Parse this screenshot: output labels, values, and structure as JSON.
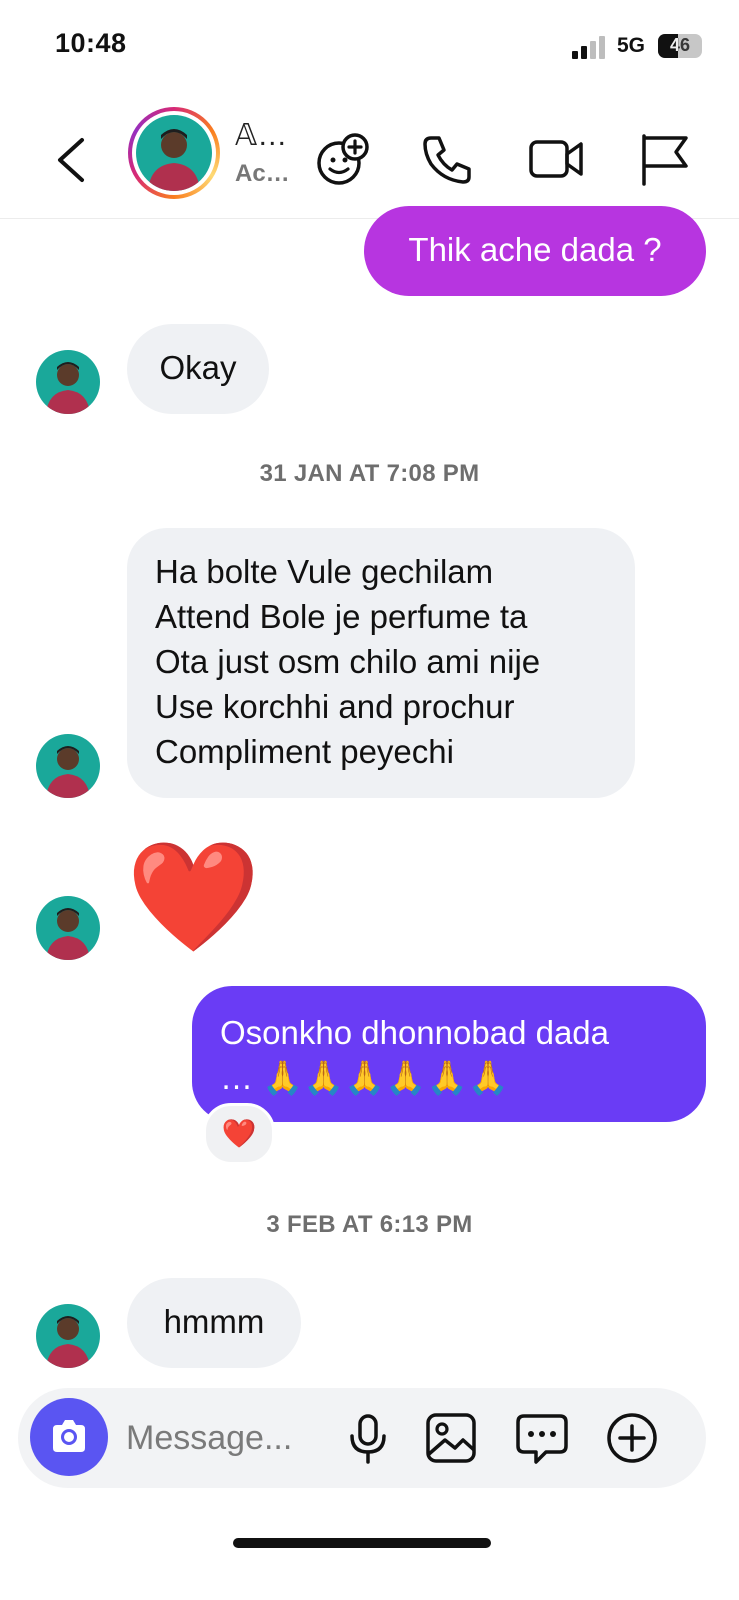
{
  "status_bar": {
    "time": "10:48",
    "network": "5G",
    "battery": "46"
  },
  "header": {
    "name": "𝔸…",
    "subtitle": "Ac…"
  },
  "messages": [
    {
      "id": "m1",
      "text": "Thik ache dada ?"
    },
    {
      "id": "m2",
      "text": "Okay"
    },
    {
      "id": "m3",
      "lines": [
        "Ha bolte Vule gechilam",
        "Attend Bole je perfume ta",
        "Ota just osm chilo ami nije",
        "Use korchhi and prochur",
        "Compliment peyechi"
      ]
    },
    {
      "id": "m4",
      "text": "❤️"
    },
    {
      "id": "m5",
      "lines": [
        "Osonkho dhonnobad dada",
        "… 🙏🙏🙏🙏🙏🙏"
      ],
      "reaction": "❤️"
    },
    {
      "id": "m6",
      "text": "hmmm"
    }
  ],
  "dates": {
    "d1": "31 JAN AT 7:08 PM",
    "d2": "3 FEB AT 6:13 PM"
  },
  "composer": {
    "placeholder": "Message..."
  },
  "colors": {
    "sent_purple": "#b735e0",
    "sent_violet": "#6a3cf5",
    "received": "#eff1f4",
    "camera_button": "#5a55f2"
  },
  "icons": [
    "back-chevron-icon",
    "add-effects-icon",
    "phone-icon",
    "video-camera-icon",
    "flag-icon",
    "camera-icon",
    "microphone-icon",
    "gallery-icon",
    "sticker-chat-icon",
    "plus-icon"
  ]
}
